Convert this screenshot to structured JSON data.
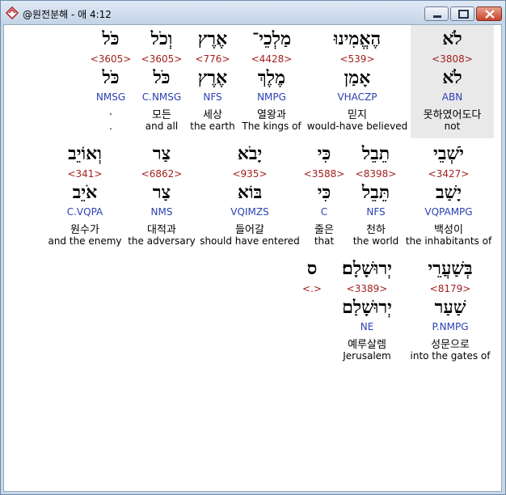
{
  "window": {
    "title": "@원전분해 - 애 4:12"
  },
  "rows": [
    [
      {
        "word": "לֹא",
        "strong": "<3808>",
        "lemma": "לֹא",
        "morph": "ABN",
        "kor": "못하였어도다",
        "eng": "not"
      },
      {
        "word": "הֶאֱמִינוּ",
        "strong": "<539>",
        "lemma": "אָמַן",
        "morph": "VHACZP",
        "kor": "믿지",
        "eng": "would-have believed"
      },
      {
        "word": "מַלְכֵי־",
        "strong": "<4428>",
        "lemma": "מֶלֶךְ",
        "morph": "NMPG",
        "kor": "열왕과",
        "eng": "The kings of"
      },
      {
        "word": "אֶרֶץ",
        "strong": "<776>",
        "lemma": "אֶרֶץ",
        "morph": "NFS",
        "kor": "세상",
        "eng": "the earth"
      },
      {
        "word": "וְכֹל",
        "strong": "<3605>",
        "lemma": "כֹּל",
        "morph": "C.NMSG",
        "kor": "모든",
        "eng": "and all"
      },
      {
        "word": "כֹּל",
        "strong": "<3605>",
        "lemma": "כֹּל",
        "morph": "NMSG",
        "kor": ".",
        "eng": "."
      }
    ],
    [
      {
        "word": "יֹשְׁבֵי",
        "strong": "<3427>",
        "lemma": "יָשַׁב",
        "morph": "VQPAMPG",
        "kor": "백성이",
        "eng": "the inhabitants of"
      },
      {
        "word": "תֵבֵל",
        "strong": "<8398>",
        "lemma": "תֵּבֵל",
        "morph": "NFS",
        "kor": "천하",
        "eng": "the world"
      },
      {
        "word": "כִּי",
        "strong": "<3588>",
        "lemma": "כִּי",
        "morph": "C",
        "kor": "줄은",
        "eng": "that"
      },
      {
        "word": "יָבֹא",
        "strong": "<935>",
        "lemma": "בּוֹא",
        "morph": "VQIMZS",
        "kor": "들어갈",
        "eng": "should have entered"
      },
      {
        "word": "צַר",
        "strong": "<6862>",
        "lemma": "צַר",
        "morph": "NMS",
        "kor": "대적과",
        "eng": "the adversary"
      },
      {
        "word": "וְאוֹיֵב",
        "strong": "<341>",
        "lemma": "אֹיֵב",
        "morph": "C.VQPA",
        "kor": "원수가",
        "eng": "and the enemy"
      }
    ],
    [
      {
        "word": "בְּשַׁעֲרֵי",
        "strong": "<8179>",
        "lemma": "שַׁעַר",
        "morph": "P.NMPG",
        "kor": "성문으로",
        "eng": "into the gates of"
      },
      {
        "word": "יְרוּשָׁלָם׃",
        "strong": "<3389>",
        "lemma": "יְרוּשָׁלַם",
        "morph": "NE",
        "kor": "예루살렘",
        "eng": "Jerusalem"
      },
      {
        "word": "ס",
        "strong": "<.>",
        "lemma": "",
        "morph": "",
        "kor": "",
        "eng": ""
      }
    ]
  ]
}
